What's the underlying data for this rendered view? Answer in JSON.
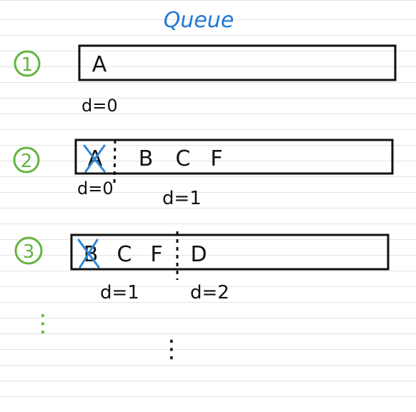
{
  "title": "Queue",
  "colors": {
    "ink": "#111111",
    "title_blue": "#1f7ad6",
    "step_green": "#63b43f",
    "strike_blue": "#2f86d8",
    "ruled_line": "#e3e3e3"
  },
  "steps": [
    {
      "number": "1",
      "cells": [
        "A"
      ],
      "depth_labels": [
        "d=0"
      ]
    },
    {
      "number": "2",
      "cells": [
        "A",
        "B",
        "C",
        "F"
      ],
      "struck": [
        "A"
      ],
      "depth_labels": [
        "d=0",
        "d=1"
      ]
    },
    {
      "number": "3",
      "cells": [
        "B",
        "C",
        "F",
        "D"
      ],
      "struck": [
        "B"
      ],
      "depth_labels": [
        "d=1",
        "d=2"
      ]
    }
  ],
  "continuation_marks": [
    "⋮",
    "⋮"
  ]
}
